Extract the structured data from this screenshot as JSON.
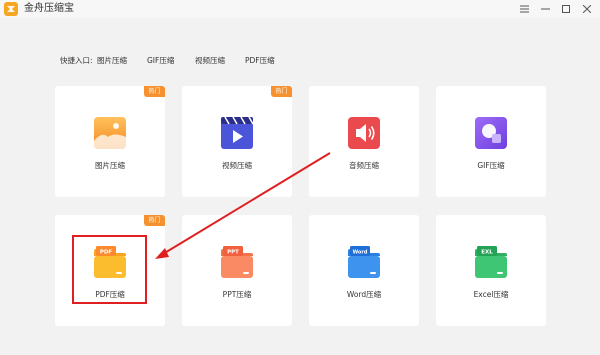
{
  "window": {
    "title": "金舟压缩宝",
    "controls": [
      "≡",
      "—",
      "☐",
      "✕"
    ]
  },
  "quick_access": {
    "label": "快捷入口:",
    "links": [
      "图片压缩",
      "GIF压缩",
      "视频压缩",
      "PDF压缩"
    ]
  },
  "badge_text": "热门",
  "cards": [
    {
      "label": "图片压缩",
      "icon": "image-icon",
      "hot": true
    },
    {
      "label": "视频压缩",
      "icon": "video-icon",
      "hot": true
    },
    {
      "label": "音频压缩",
      "icon": "audio-icon",
      "hot": false
    },
    {
      "label": "GIF压缩",
      "icon": "gif-icon",
      "hot": false
    },
    {
      "label": "PDF压缩",
      "icon": "pdf-folder-icon",
      "tag": "PDF",
      "hot": true
    },
    {
      "label": "PPT压缩",
      "icon": "ppt-folder-icon",
      "tag": "PPT",
      "hot": false
    },
    {
      "label": "Word压缩",
      "icon": "word-folder-icon",
      "tag": "Word",
      "hot": false
    },
    {
      "label": "Excel压缩",
      "icon": "excel-folder-icon",
      "tag": "EXL",
      "hot": false
    }
  ],
  "colors": {
    "background": "#f2f2f2",
    "hot_badge": "#f5922f",
    "highlight": "#e02020",
    "image": "#f7a534",
    "video": "#4a55d9",
    "audio": "#ea4a4d",
    "gif": "#8b5cf0",
    "pdf": "#fbbd2e",
    "ppt": "#f98a64",
    "word": "#3d93ee",
    "excel": "#3fc675"
  }
}
